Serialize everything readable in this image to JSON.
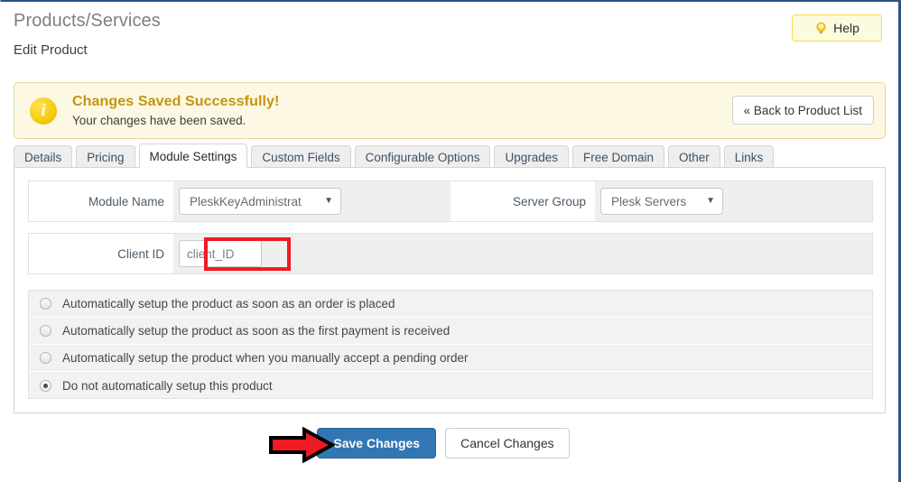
{
  "header": {
    "title": "Products/Services",
    "subtitle": "Edit Product",
    "help_label": "Help",
    "help_icon": "lightbulb-icon"
  },
  "alert": {
    "icon": "info-circle-icon",
    "icon_glyph": "i",
    "title": "Changes Saved Successfully!",
    "message": "Your changes have been saved.",
    "back_button": "« Back to Product List"
  },
  "tabs": [
    {
      "label": "Details",
      "active": false
    },
    {
      "label": "Pricing",
      "active": false
    },
    {
      "label": "Module Settings",
      "active": true
    },
    {
      "label": "Custom Fields",
      "active": false
    },
    {
      "label": "Configurable Options",
      "active": false
    },
    {
      "label": "Upgrades",
      "active": false
    },
    {
      "label": "Free Domain",
      "active": false
    },
    {
      "label": "Other",
      "active": false
    },
    {
      "label": "Links",
      "active": false
    }
  ],
  "fields": {
    "module_name": {
      "label": "Module Name",
      "value": "PleskKeyAdministrat",
      "caret_icon": "chevron-down-icon"
    },
    "server_group": {
      "label": "Server Group",
      "value": "Plesk Servers",
      "caret_icon": "chevron-down-icon"
    },
    "client_id": {
      "label": "Client ID",
      "value": "client_ID"
    }
  },
  "setup_options": [
    {
      "label": "Automatically setup the product as soon as an order is placed",
      "selected": false
    },
    {
      "label": "Automatically setup the product as soon as the first payment is received",
      "selected": false
    },
    {
      "label": "Automatically setup the product when you manually accept a pending order",
      "selected": false
    },
    {
      "label": "Do not automatically setup this product",
      "selected": true
    }
  ],
  "footer": {
    "save_label": "Save Changes",
    "cancel_label": "Cancel Changes"
  },
  "annotations": {
    "highlight_color": "#ee1b24",
    "arrow_color": "#ee1b24",
    "arrow_outline": "#000000",
    "highlight_target": "client_id_field",
    "arrow_target": "save_changes_button"
  },
  "colors": {
    "primary_button": "#3277b3",
    "alert_background": "#fcf8e3",
    "alert_title": "#c59510",
    "help_background": "#fdfbdd",
    "page_border": "#2b5484"
  }
}
